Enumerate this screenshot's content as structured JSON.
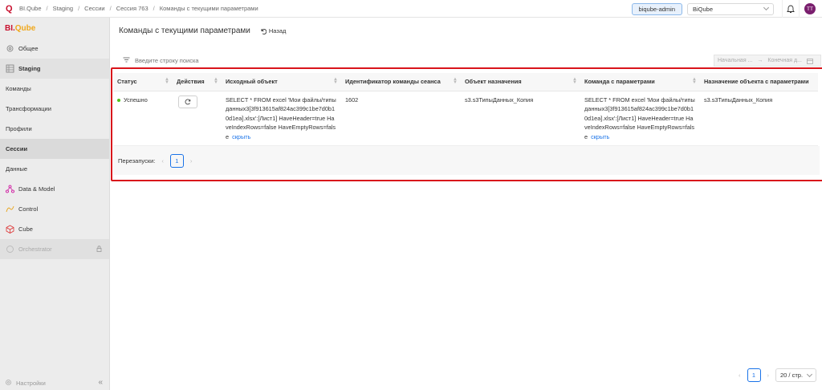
{
  "breadcrumb": {
    "brand": "BI.Qube",
    "items": [
      "Staging",
      "Сессии",
      "Сессия 763",
      "Команды с текущими параметрами"
    ]
  },
  "topbar": {
    "user": "biqube-admin",
    "workspace": "BiQube",
    "avatar_initials": "TT"
  },
  "sidebar": {
    "brand_left": "BI.",
    "brand_right": "Qube",
    "items": [
      {
        "label": "Общее"
      },
      {
        "label": "Staging"
      },
      {
        "label": "Команды"
      },
      {
        "label": "Трансформации"
      },
      {
        "label": "Профили"
      },
      {
        "label": "Сессии"
      },
      {
        "label": "Данные"
      },
      {
        "label": "Data & Model"
      },
      {
        "label": "Control"
      },
      {
        "label": "Cube"
      },
      {
        "label": "Orchestrator"
      }
    ],
    "footer": "Настройки"
  },
  "page": {
    "title": "Команды с текущими параметрами",
    "back": "Назад",
    "search_placeholder": "Введите строку поиска",
    "date_start": "Начальная ...",
    "date_end": "Конечная д..."
  },
  "table": {
    "columns": [
      "Статус",
      "Действия",
      "Исходный объект",
      "Идентификатор команды сеанса",
      "Объект назначения",
      "Команда с параметрами",
      "Назначение объекта с параметрами"
    ],
    "row": {
      "status": "Успешно",
      "source": "SELECT * FROM excel 'Мои файлы/типы данных3[3f913615af824ac399c1be7d0b10d1ea].xlsx':[Лист1] HaveHeader=true HaveIndexRows=false HaveEmptyRows=false",
      "session_cmd_id": "1602",
      "target": "s3.s3ТипыДанных_Копия",
      "command": "SELECT * FROM excel 'Мои файлы/типы данных3[3f913615af824ac399c1be7d0b10d1ea].xlsx':[Лист1] HaveHeader=true HaveIndexRows=false HaveEmptyRows=false",
      "target_param": "s3.s3ТипыДанных_Копия",
      "hide_label": "скрыть"
    },
    "restarts_label": "Перезапуски:",
    "restarts_page": "1"
  },
  "pager": {
    "page": "1",
    "page_size": "20 / стр."
  }
}
